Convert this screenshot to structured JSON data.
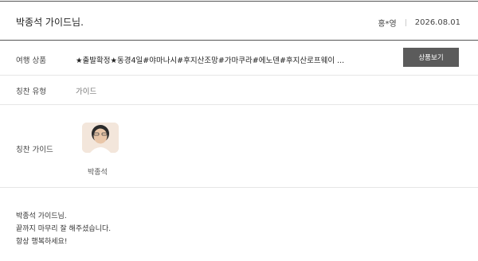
{
  "header": {
    "title": "박종석 가이드님.",
    "author": "홍*영",
    "date": "2026.08.01"
  },
  "trip_product": {
    "label": "여행 상품",
    "value": "★출발확정★동경4일#야마나시#후지산조망#가마쿠라#에노덴#후지산로프웨이 ...",
    "button_label": "상품보기"
  },
  "praise_type": {
    "label": "칭찬 유형",
    "value": "가이드"
  },
  "praise_guide": {
    "label": "칭찬 가이드",
    "guide_name": "박종석",
    "avatar_icon": "guide-photo"
  },
  "message": {
    "lines": [
      "박종석 가이드님.",
      "끝까지 마무리 잘 해주셨습니다.",
      "항상 행복하세요!"
    ]
  },
  "colors": {
    "button_bg": "#5b5b5b",
    "border_dark": "#555555",
    "border_light": "#e6e6e6"
  }
}
